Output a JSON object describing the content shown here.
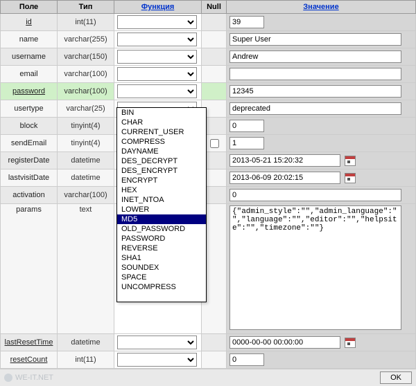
{
  "headers": {
    "field": "Поле",
    "type": "Тип",
    "function": "Функция",
    "null": "Null",
    "value": "Значение"
  },
  "rows": [
    {
      "field": "id",
      "type": "int(11)",
      "value": "39",
      "size": "short",
      "underline": true
    },
    {
      "field": "name",
      "type": "varchar(255)",
      "value": "Super User",
      "size": "long"
    },
    {
      "field": "username",
      "type": "varchar(150)",
      "value": "Andrew",
      "size": "long"
    },
    {
      "field": "email",
      "type": "varchar(100)",
      "value": "",
      "size": "long"
    },
    {
      "field": "password",
      "type": "varchar(100)",
      "value": "12345",
      "size": "long",
      "highlight": true,
      "underline": true
    },
    {
      "field": "usertype",
      "type": "varchar(25)",
      "value": "deprecated",
      "size": "long"
    },
    {
      "field": "block",
      "type": "tinyint(4)",
      "value": "0",
      "size": "short"
    },
    {
      "field": "sendEmail",
      "type": "tinyint(4)",
      "value": "1",
      "size": "short",
      "nullCheckbox": true
    },
    {
      "field": "registerDate",
      "type": "datetime",
      "value": "2013-05-21 15:20:32",
      "size": "mid",
      "calendar": true
    },
    {
      "field": "lastvisitDate",
      "type": "datetime",
      "value": "2013-06-09 20:02:15",
      "size": "mid",
      "calendar": true
    },
    {
      "field": "activation",
      "type": "varchar(100)",
      "value": "0",
      "size": "long"
    },
    {
      "field": "params",
      "type": "text",
      "value": "{\"admin_style\":\"\",\"admin_language\":\"\",\"language\":\"\",\"editor\":\"\",\"helpsite\":\"\",\"timezone\":\"\"}",
      "size": "textarea"
    },
    {
      "field": "lastResetTime",
      "type": "datetime",
      "value": "0000-00-00 00:00:00",
      "size": "mid",
      "calendar": true,
      "underline": true
    },
    {
      "field": "resetCount",
      "type": "int(11)",
      "value": "0",
      "size": "short",
      "underline": true
    }
  ],
  "dropdown": {
    "options": [
      "BIN",
      "CHAR",
      "CURRENT_USER",
      "COMPRESS",
      "DAYNAME",
      "DES_DECRYPT",
      "DES_ENCRYPT",
      "ENCRYPT",
      "HEX",
      "INET_NTOA",
      "LOWER",
      "MD5",
      "OLD_PASSWORD",
      "PASSWORD",
      "REVERSE",
      "SHA1",
      "SOUNDEX",
      "SPACE",
      "UNCOMPRESS"
    ],
    "selected": "MD5"
  },
  "footer": {
    "watermark": "WE-IT.NET",
    "ok": "OK"
  }
}
